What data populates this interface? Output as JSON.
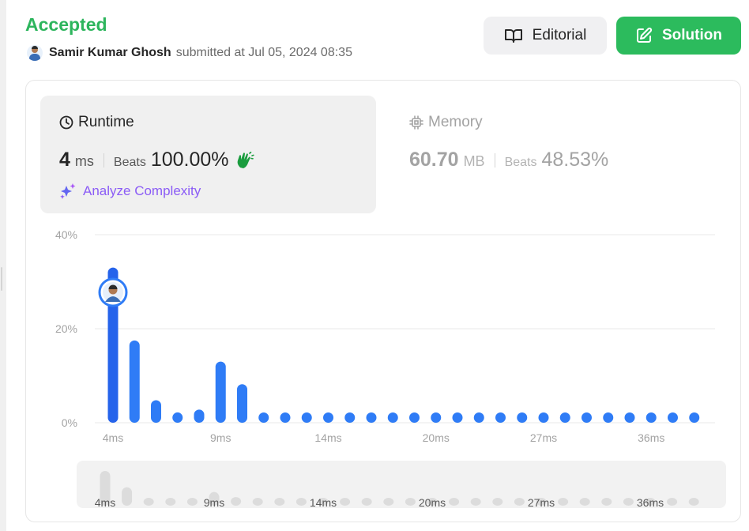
{
  "submission": {
    "status": "Accepted",
    "author": "Samir Kumar Ghosh",
    "submitted_text": "submitted at Jul 05, 2024 08:35"
  },
  "buttons": {
    "editorial_label": "Editorial",
    "solution_label": "Solution"
  },
  "runtime": {
    "title": "Runtime",
    "value": "4",
    "unit": "ms",
    "beats_label": "Beats",
    "beats_value": "100.00%",
    "analyze_label": "Analyze Complexity"
  },
  "memory": {
    "title": "Memory",
    "value": "60.70",
    "unit": "MB",
    "beats_label": "Beats",
    "beats_value": "48.53%"
  },
  "colors": {
    "accepted": "#2db55d",
    "solution_button": "#2cbb5d",
    "bar": "#2f7cf6",
    "bar_highlight": "#2563eb",
    "analyze": "#8b5cf6",
    "navigator_bar": "#dcdcdc"
  },
  "icons": {
    "editorial": "open-book-icon",
    "solution": "edit-square-icon",
    "runtime": "clock-icon",
    "memory": "chip-icon",
    "analyze": "sparkle-icon",
    "beats": "clap-hands-icon"
  },
  "chart_data": {
    "type": "bar",
    "title": "",
    "xlabel": "",
    "ylabel": "",
    "ylim": [
      0,
      40
    ],
    "y_tick_labels": [
      "0%",
      "20%",
      "40%"
    ],
    "x_tick_labels": [
      "4ms",
      "9ms",
      "14ms",
      "20ms",
      "27ms",
      "36ms"
    ],
    "x_tick_bar_index": [
      0,
      5,
      10,
      15,
      20,
      25
    ],
    "highlight_bar_index": 0,
    "grid": true,
    "values": [
      33.0,
      17.5,
      4.8,
      2.2,
      2.8,
      13.0,
      8.2,
      1.8,
      1.2,
      1.2,
      1.2,
      1.2,
      1.2,
      1.2,
      1.2,
      1.2,
      1.2,
      1.2,
      1.2,
      1.2,
      1.2,
      1.2,
      1.2,
      1.2,
      1.2,
      1.2,
      1.2,
      1.2
    ]
  }
}
